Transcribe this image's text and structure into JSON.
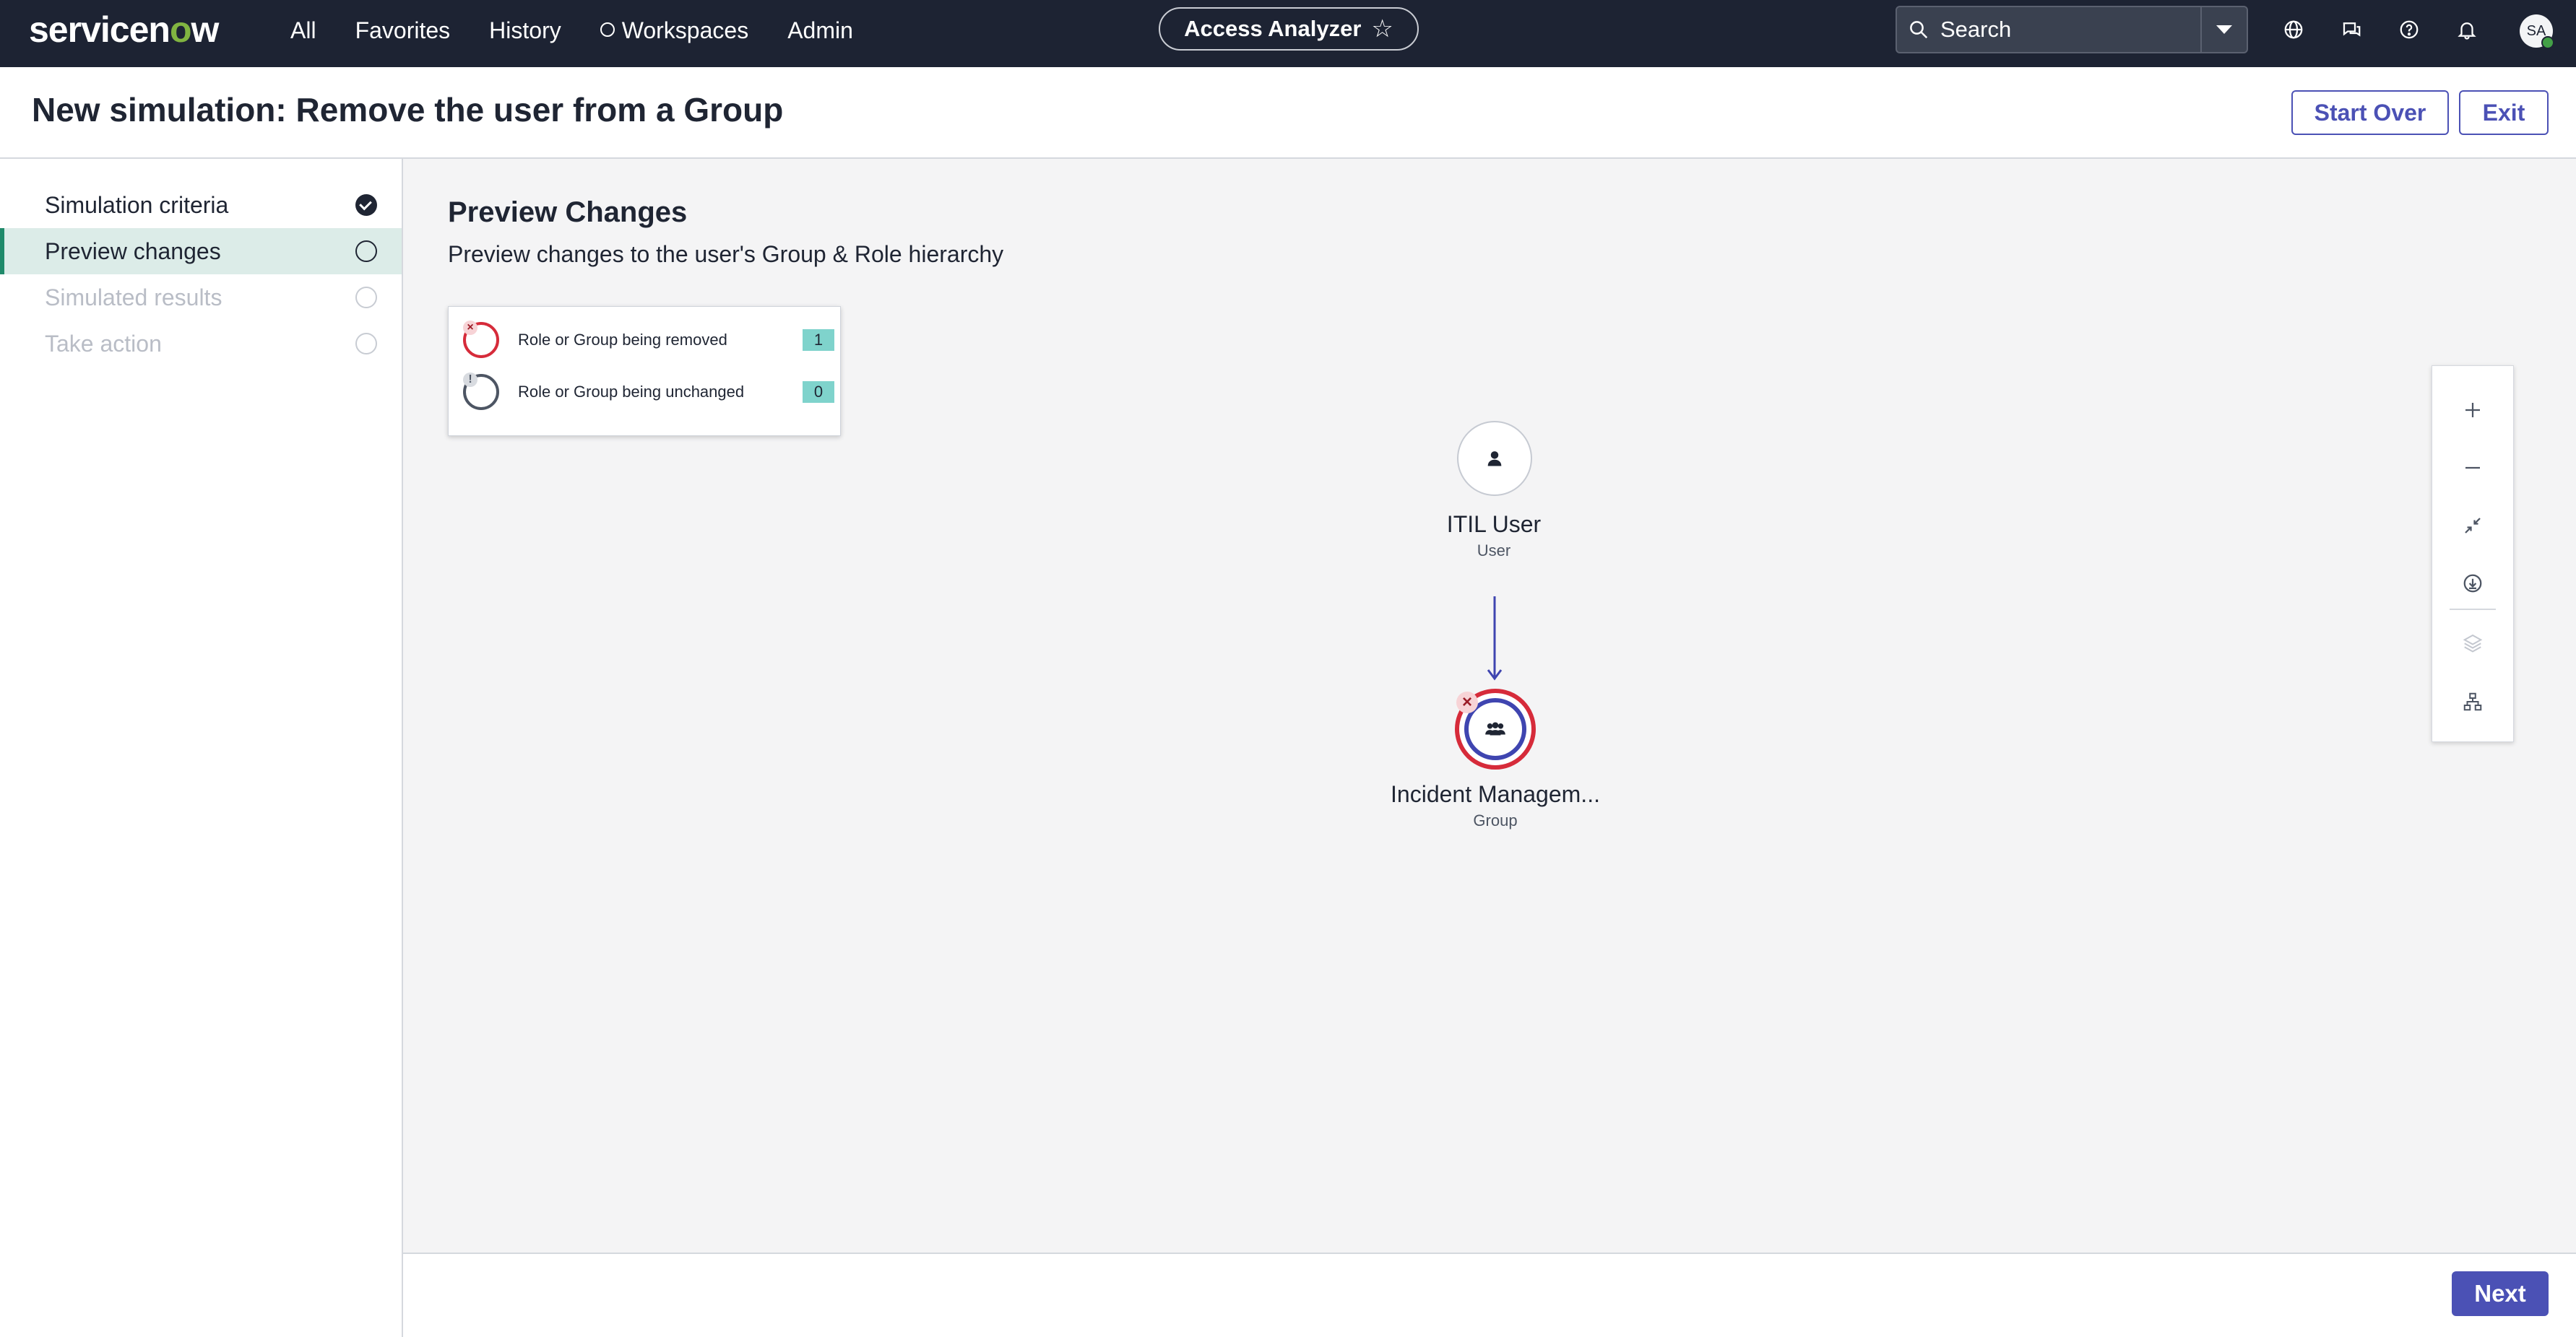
{
  "topnav": {
    "logo_text": "servicen",
    "logo_o": "o",
    "logo_end": "w",
    "links": [
      "All",
      "Favorites",
      "History",
      "Workspaces",
      "Admin"
    ],
    "app_pill": "Access Analyzer",
    "search_placeholder": "Search",
    "avatar_initials": "SA",
    "icons": [
      "globe-icon",
      "chat-icon",
      "help-icon",
      "bell-icon"
    ]
  },
  "header": {
    "title": "New simulation: Remove the user from a Group",
    "start_over_label": "Start Over",
    "exit_label": "Exit"
  },
  "sidebar": {
    "steps": [
      {
        "label": "Simulation criteria",
        "state": "done"
      },
      {
        "label": "Preview changes",
        "state": "active"
      },
      {
        "label": "Simulated results",
        "state": "pending"
      },
      {
        "label": "Take action",
        "state": "pending"
      }
    ]
  },
  "main": {
    "title": "Preview Changes",
    "subtitle": "Preview changes to the user's Group & Role hierarchy",
    "legend": [
      {
        "label": "Role or Group being removed",
        "count": "1"
      },
      {
        "label": "Role or Group being unchanged",
        "count": "0"
      }
    ],
    "nodes": [
      {
        "name": "ITIL User",
        "type": "User"
      },
      {
        "name": "Incident Managem...",
        "type": "Group"
      }
    ]
  },
  "toolbar": {
    "tools": [
      "zoom-in-icon",
      "zoom-out-icon",
      "fit-to-screen-icon",
      "download-icon",
      "layers-icon",
      "hierarchy-icon"
    ]
  },
  "footer": {
    "next_label": "Next"
  },
  "colors": {
    "nav_bg": "#1d2333",
    "primary": "#4b51b5",
    "removed": "#d62b3a",
    "active_step_bg": "#dcece8",
    "count_badge": "#7fd3cc"
  }
}
